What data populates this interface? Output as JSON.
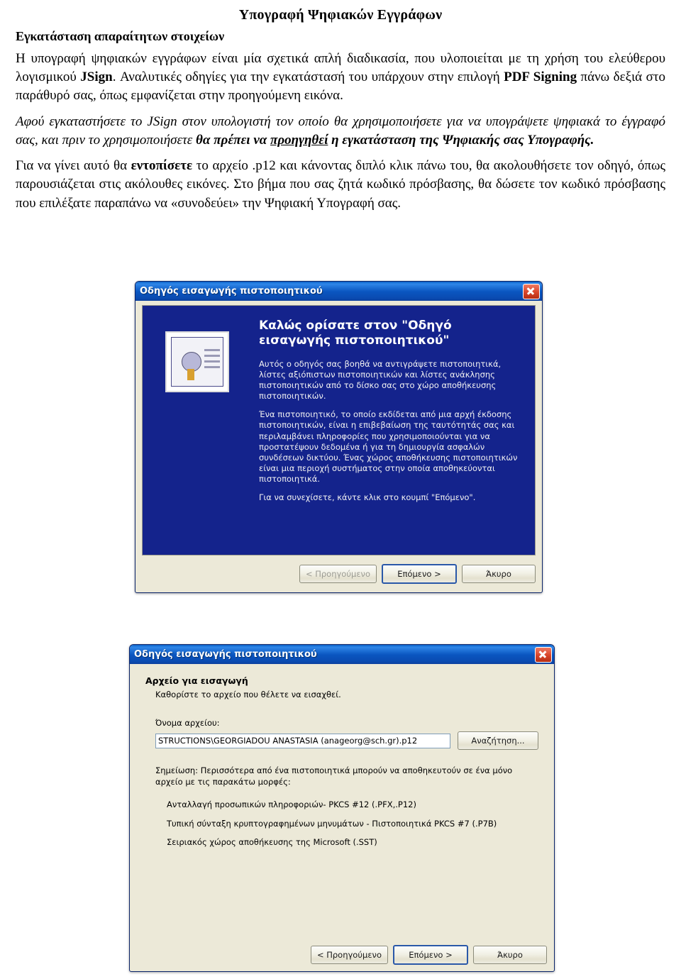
{
  "document": {
    "title": "Υπογραφή Ψηφιακών Εγγράφων",
    "section_heading": "Εγκατάσταση απαραίτητων στοιχείων",
    "paragraph1_part1": "Η υπογραφή ψηφιακών εγγράφων είναι μία σχετικά απλή διαδικασία, που υλοποιείται με τη χρήση του ελεύθερου λογισμικού ",
    "paragraph1_bold1": "JSign",
    "paragraph1_part2": ". Αναλυτικές οδηγίες για την εγκατάστασή του υπάρχουν στην επιλογή ",
    "paragraph1_bold2": "PDF Signing",
    "paragraph1_part3": " πάνω δεξιά στο παράθυρό σας, όπως εμφανίζεται στην προηγούμενη εικόνα.",
    "paragraph2_part1": "Αφού εγκαταστήσετε το JSign στον υπολογιστή τον οποίο θα χρησιμοποιήσετε για να υπογράψετε ψηφιακά το έγγραφό σας,  και πριν το χρησιμοποιήσετε ",
    "paragraph2_bold1": "θα πρέπει να ",
    "paragraph2_boldunderline": "προηγηθεί",
    "paragraph2_bold2": " η εγκατάσταση της Ψηφιακής σας Υπογραφής",
    "paragraph2_part2": ".",
    "paragraph3_part1": "Για να γίνει αυτό θα ",
    "paragraph3_bold1": "εντοπίσετε",
    "paragraph3_part2": " το αρχείο ",
    "paragraph3_part3": ".p12 και κάνοντας διπλό κλικ πάνω του, θα ακολουθήσετε τον οδηγό, όπως παρουσιάζεται στις ακόλουθες εικόνες. Στο βήμα που σας ζητά κωδικό πρόσβασης, θα δώσετε τον κωδικό πρόσβασης που επιλέξατε παραπάνω να «συνοδεύει» την Ψηφιακή Υπογραφή σας."
  },
  "dialog1": {
    "title": "Οδηγός εισαγωγής πιστοποιητικού",
    "close_icon": "close-icon",
    "certificate-icon": "certificate-icon",
    "heading_line1": "Καλώς ορίσατε στον \"Οδηγό",
    "heading_line2": "εισαγωγής πιστοποιητικού\"",
    "para1": "Αυτός ο οδηγός σας βοηθά να αντιγράψετε πιστοποιητικά, λίστες αξιόπιστων πιστοποιητικών και λίστες ανάκλησης πιστοποιητικών από το δίσκο σας στο χώρο αποθήκευσης πιστοποιητικών.",
    "para2": "Ένα πιστοποιητικό, το οποίο εκδίδεται από μια αρχή έκδοσης πιστοποιητικών, είναι η επιβεβαίωση της ταυτότητάς σας και περιλαμβάνει πληροφορίες που χρησιμοποιούνται για να προστατέψουν δεδομένα ή για τη δημιουργία ασφαλών συνδέσεων δικτύου. Ένας χώρος αποθήκευσης πιστοποιητικών είναι μια περιοχή συστήματος στην οποία αποθηκεύονται πιστοποιητικά.",
    "para3": "Για να συνεχίσετε, κάντε κλικ στο κουμπί \"Επόμενο\".",
    "buttons": {
      "back": "< Προηγούμενο",
      "next": "Επόμενο >",
      "cancel": "Άκυρο"
    }
  },
  "dialog2": {
    "title": "Οδηγός εισαγωγής πιστοποιητικού",
    "close_icon": "close-icon",
    "step_title": "Αρχείο για εισαγωγή",
    "step_sub": "Καθορίστε το αρχείο που θέλετε να εισαχθεί.",
    "field_label": "Όνομα αρχείου:",
    "field_value": "STRUCTIONS\\GEORGIADOU ANASTASIA (anageorg@sch.gr).p12",
    "browse_button": "Αναζήτηση...",
    "note": "Σημείωση:  Περισσότερα από ένα πιστοποιητικά μπορούν να αποθηκευτούν σε ένα μόνο αρχείο με τις παρακάτω μορφές:",
    "formats": [
      "Ανταλλαγή προσωπικών πληροφοριών- PKCS #12 (.PFX,.P12)",
      "Τυπική σύνταξη κρυπτογραφημένων μηνυμάτων - Πιστοποιητικά PKCS #7 (.P7B)",
      "Σειριακός χώρος αποθήκευσης της Microsoft (.SST)"
    ],
    "buttons": {
      "back": "< Προηγούμενο",
      "next": "Επόμενο >",
      "cancel": "Άκυρο"
    }
  }
}
